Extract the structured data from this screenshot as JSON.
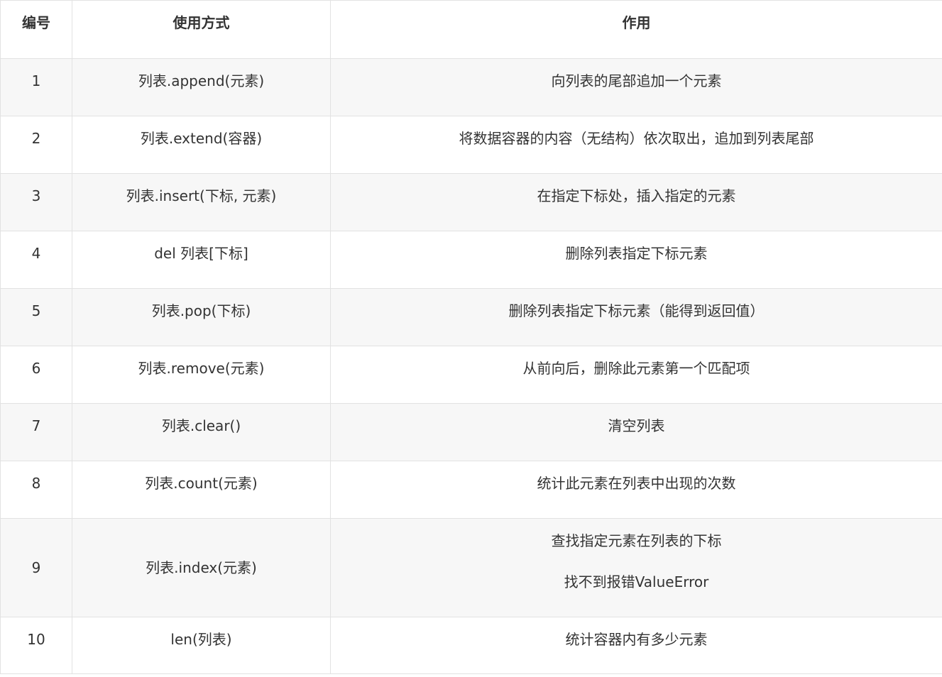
{
  "table": {
    "headers": [
      "编号",
      "使用方式",
      "作用"
    ],
    "rows": [
      {
        "id": "1",
        "usage": "列表.append(元素)",
        "desc": [
          "向列表的尾部追加一个元素"
        ]
      },
      {
        "id": "2",
        "usage": "列表.extend(容器)",
        "desc": [
          "将数据容器的内容（无结构）依次取出，追加到列表尾部"
        ]
      },
      {
        "id": "3",
        "usage": "列表.insert(下标, 元素)",
        "desc": [
          "在指定下标处，插入指定的元素"
        ]
      },
      {
        "id": "4",
        "usage": "del 列表[下标]",
        "desc": [
          "删除列表指定下标元素"
        ]
      },
      {
        "id": "5",
        "usage": "列表.pop(下标)",
        "desc": [
          "删除列表指定下标元素（能得到返回值）"
        ]
      },
      {
        "id": "6",
        "usage": "列表.remove(元素)",
        "desc": [
          "从前向后，删除此元素第一个匹配项"
        ]
      },
      {
        "id": "7",
        "usage": "列表.clear()",
        "desc": [
          "清空列表"
        ]
      },
      {
        "id": "8",
        "usage": "列表.count(元素)",
        "desc": [
          "统计此元素在列表中出现的次数"
        ]
      },
      {
        "id": "9",
        "usage": "列表.index(元素)",
        "desc": [
          "查找指定元素在列表的下标",
          "找不到报错ValueError"
        ]
      },
      {
        "id": "10",
        "usage": "len(列表)",
        "desc": [
          "统计容器内有多少元素"
        ]
      }
    ]
  }
}
